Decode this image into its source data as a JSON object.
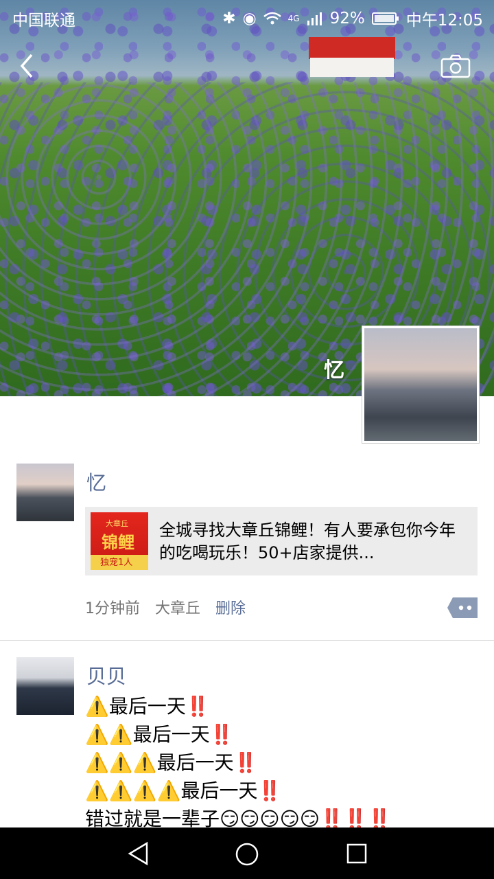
{
  "status_bar": {
    "carrier": "中国联通",
    "battery": "92%",
    "time": "中午12:05",
    "network": "4G"
  },
  "header": {
    "back_icon": "back-chevron-icon",
    "camera_icon": "camera-icon"
  },
  "profile": {
    "name": "忆"
  },
  "posts": [
    {
      "author": "忆",
      "link_title": "全城寻找大章丘锦鲤！有人要承包你今年的吃喝玩乐！50+店家提供...",
      "thumb_badge": "大章丘",
      "thumb_title": "锦鲤",
      "thumb_footer": "独宠1人",
      "time": "1分钟前",
      "location": "大章丘",
      "delete_label": "删除"
    },
    {
      "author": "贝贝",
      "lines": [
        "⚠️最后一天‼️",
        "⚠️⚠️最后一天‼️",
        "⚠️⚠️⚠️最后一天‼️",
        "⚠️⚠️⚠️⚠️最后一天‼️",
        "错过就是一辈子😏😏😏😏😏‼️‼️‼️"
      ]
    }
  ],
  "colors": {
    "link_blue": "#576b95",
    "card_bg": "#ececec"
  }
}
